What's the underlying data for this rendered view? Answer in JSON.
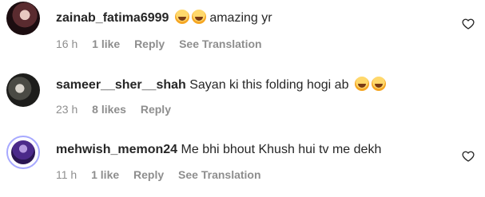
{
  "comments": [
    {
      "username": "zainab_fatima6999",
      "text": "amazing yr",
      "emojis": [
        "face-with-tears-of-joy",
        "face-with-tears-of-joy"
      ],
      "time": "16 h",
      "likes": "1 like",
      "reply": "Reply",
      "translate": "See Translation"
    },
    {
      "username": "sameer__sher__shah",
      "text": "Sayan ki this folding hogi ab",
      "emojis": [
        "face-with-tears-of-joy",
        "face-with-tears-of-joy"
      ],
      "time": "23 h",
      "likes": "8 likes",
      "reply": "Reply"
    },
    {
      "username": "mehwish_memon24",
      "text": "Me bhi bhout Khush hui tv me dekh",
      "time": "11 h",
      "likes": "1 like",
      "reply": "Reply",
      "translate": "See Translation"
    }
  ]
}
